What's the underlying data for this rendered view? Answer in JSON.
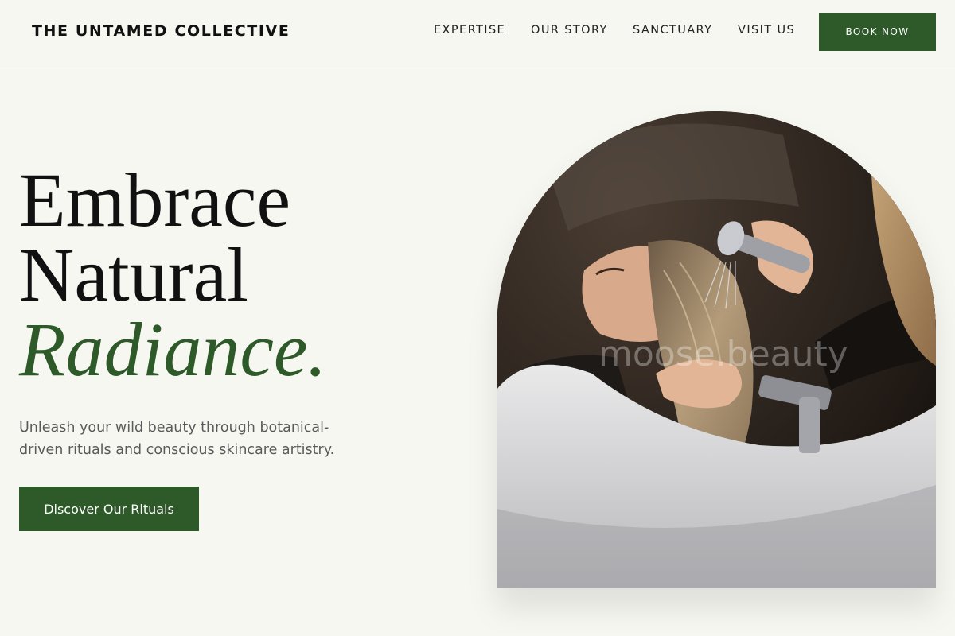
{
  "header": {
    "brand": "THE UNTAMED COLLECTIVE",
    "nav": [
      "EXPERTISE",
      "OUR STORY",
      "SANCTUARY",
      "VISIT US"
    ],
    "book_label": "BOOK NOW"
  },
  "hero": {
    "headline_line1": "Embrace",
    "headline_line2": "Natural",
    "headline_accent": "Radiance.",
    "subtext": "Unleash your wild beauty through botanical-driven rituals and conscious skincare artistry.",
    "cta_label": "Discover Our Rituals",
    "image_watermark": "moose.beauty"
  },
  "colors": {
    "background": "#f7f7f2",
    "accent": "#2e5a2a",
    "text": "#111111",
    "muted": "#5a5a5a"
  }
}
